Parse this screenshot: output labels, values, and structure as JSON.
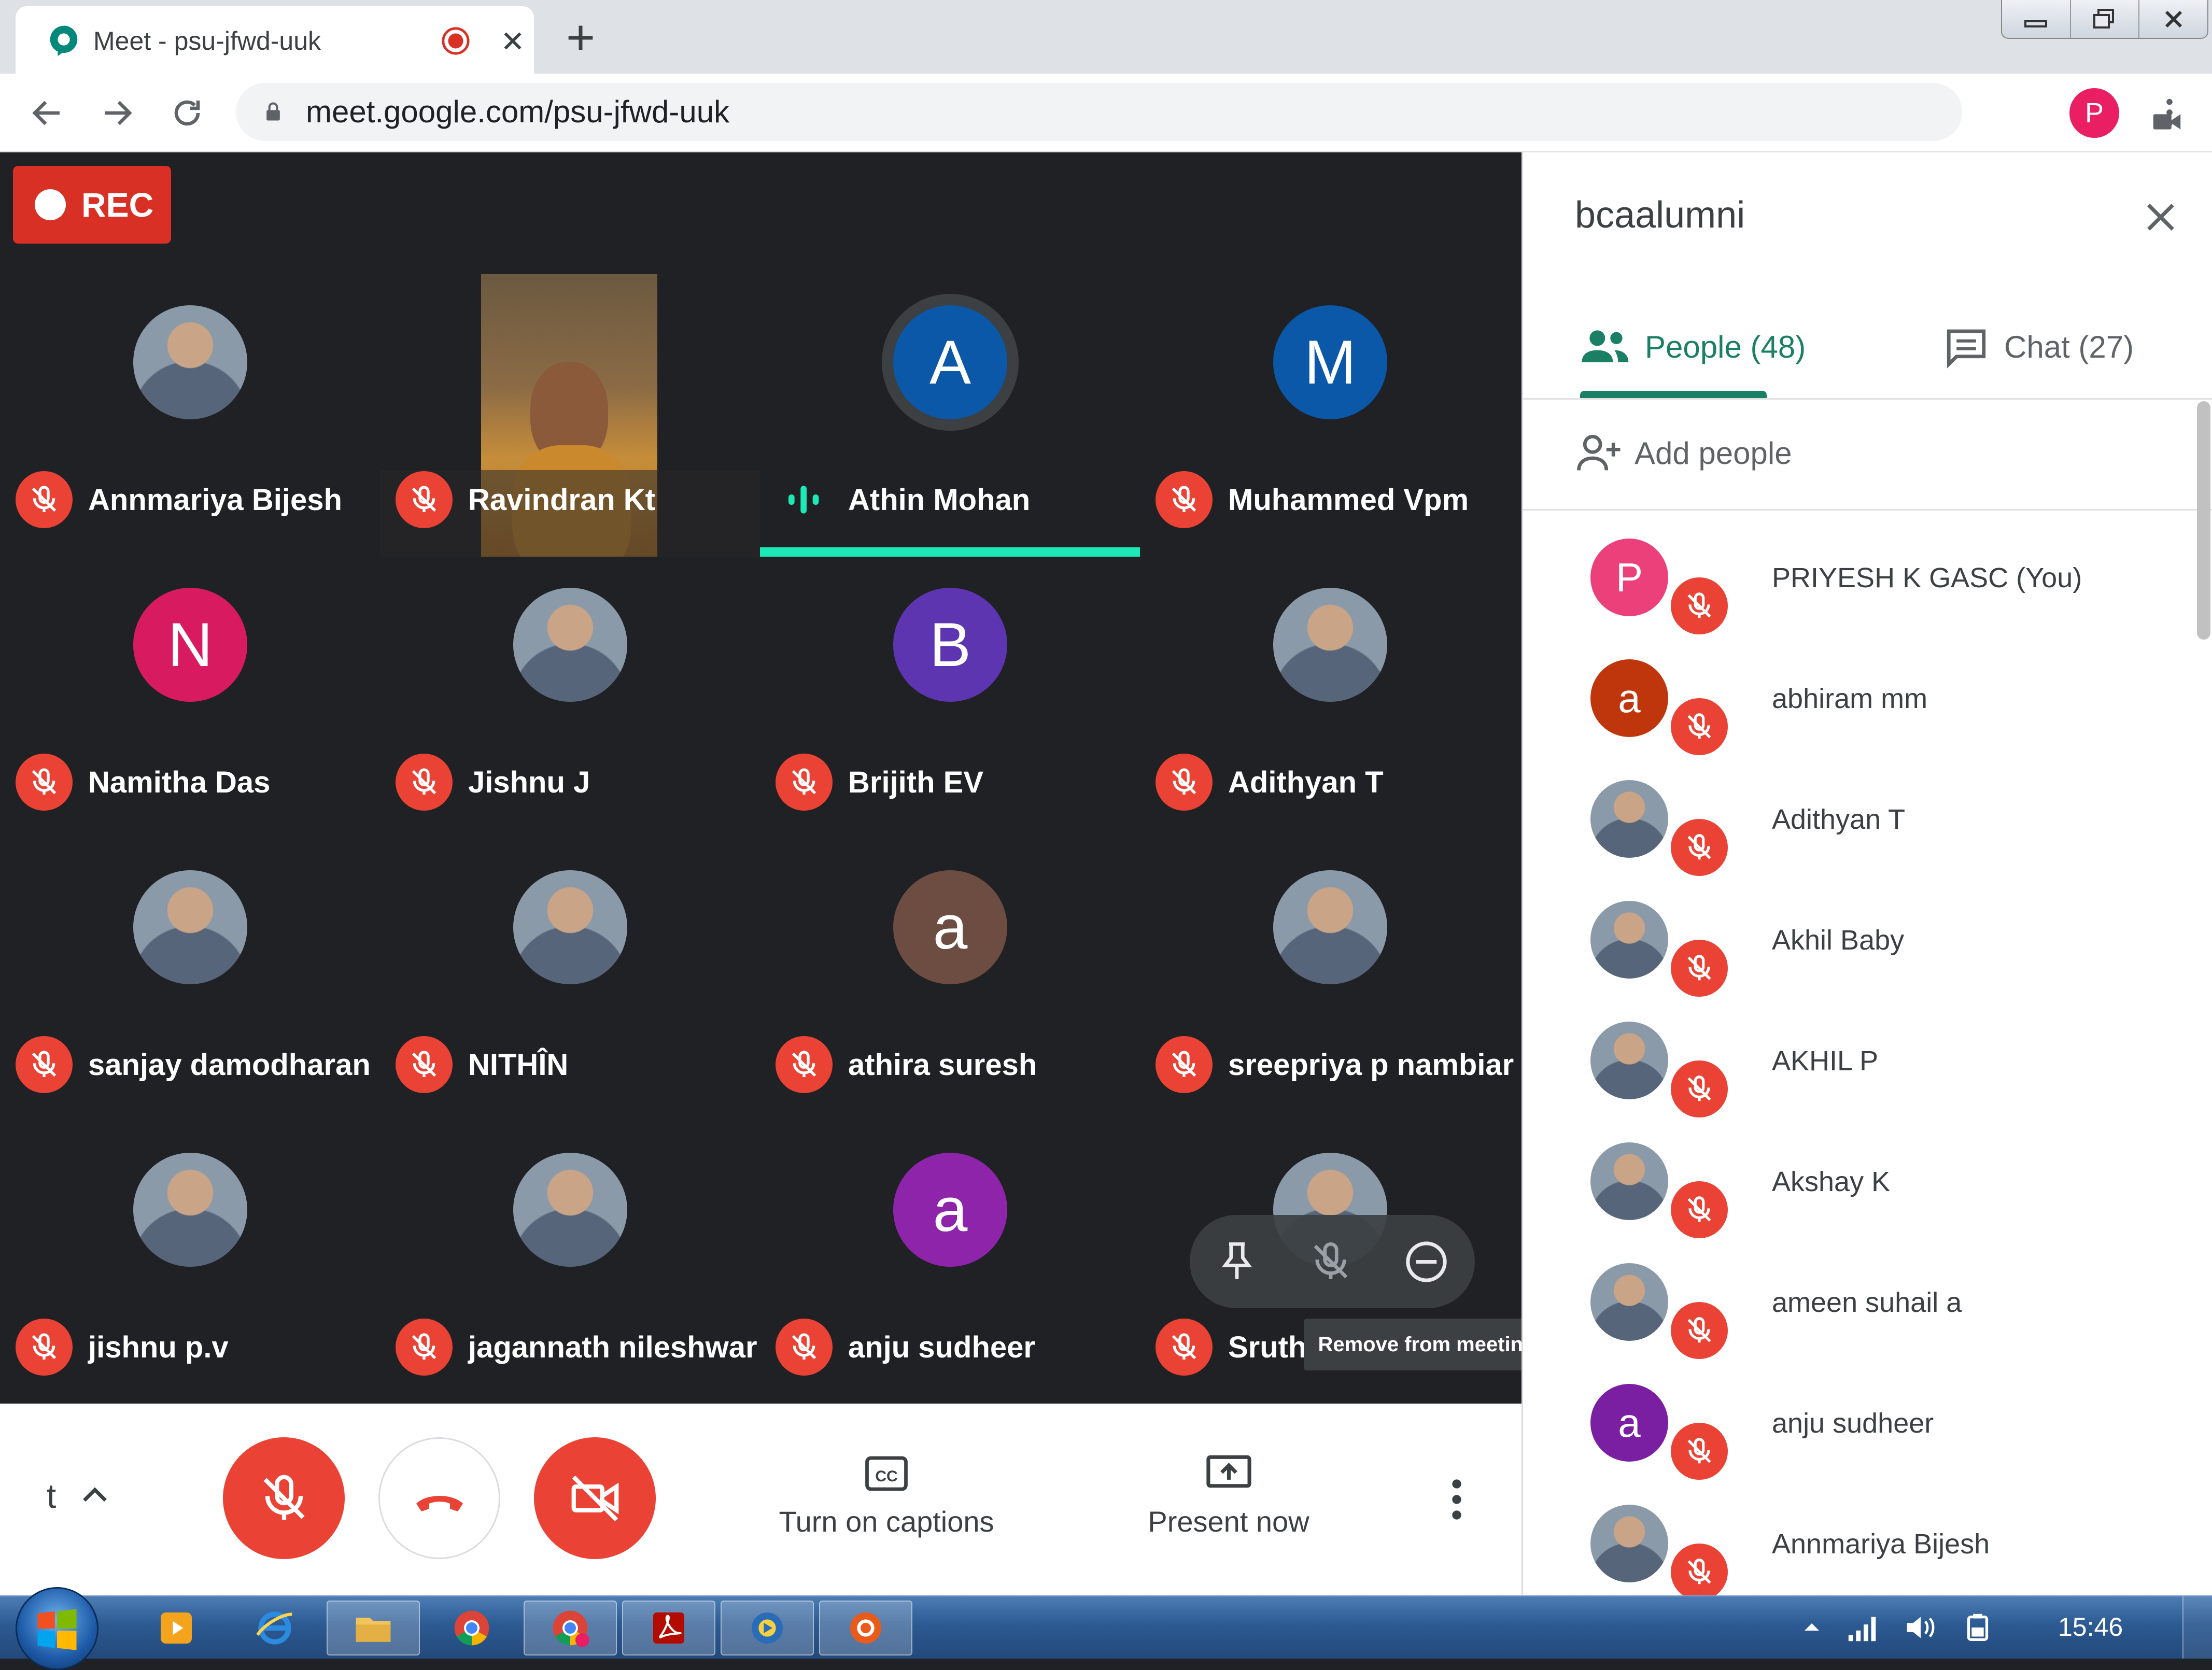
{
  "browser": {
    "tab_title": "Meet - psu-jfwd-uuk",
    "url": "meet.google.com/psu-jfwd-uuk",
    "profile_initial": "P",
    "profile_color": "#e91e63"
  },
  "meet": {
    "rec_label": "REC",
    "meeting_code_short": "t",
    "tiles": [
      {
        "name": "Annmariya Bijesh",
        "avatar_type": "photo",
        "muted": true
      },
      {
        "name": "Ravindran Kt",
        "avatar_type": "video",
        "muted": true
      },
      {
        "name": "Athin Mohan",
        "avatar_type": "letter",
        "initial": "A",
        "color": "#0b57a8",
        "muted": false,
        "speaking": true
      },
      {
        "name": "Muhammed Vpm",
        "avatar_type": "letter",
        "initial": "M",
        "color": "#0b57a8",
        "muted": true
      },
      {
        "name": "Namitha Das",
        "avatar_type": "letter",
        "initial": "N",
        "color": "#d81b60",
        "muted": true
      },
      {
        "name": "Jishnu J",
        "avatar_type": "photo",
        "muted": true
      },
      {
        "name": "Brijith EV",
        "avatar_type": "letter",
        "initial": "B",
        "color": "#5e35b1",
        "muted": true
      },
      {
        "name": "Adithyan T",
        "avatar_type": "photo",
        "muted": true
      },
      {
        "name": "sanjay damodharan",
        "avatar_type": "photo",
        "muted": true
      },
      {
        "name": "NITHÎN",
        "avatar_type": "photo",
        "muted": true
      },
      {
        "name": "athira suresh",
        "avatar_type": "letter",
        "initial": "a",
        "color": "#6d4c41",
        "muted": true
      },
      {
        "name": "sreepriya p nambiar",
        "avatar_type": "photo",
        "muted": true
      },
      {
        "name": "jishnu p.v",
        "avatar_type": "photo",
        "muted": true
      },
      {
        "name": "jagannath nileshwar",
        "avatar_type": "photo",
        "muted": true
      },
      {
        "name": "anju sudheer",
        "avatar_type": "letter",
        "initial": "a",
        "color": "#8e24aa",
        "muted": true
      },
      {
        "name": "Sruthi B Ramesan",
        "avatar_type": "photo",
        "muted": true
      }
    ],
    "tooltip": "Remove from meeting",
    "controls": {
      "captions_label": "Turn on captions",
      "present_label": "Present now"
    }
  },
  "panel": {
    "meeting_name": "bcaalumni",
    "people_tab": "People (48)",
    "chat_tab": "Chat (27)",
    "add_people": "Add people",
    "people": [
      {
        "name": "PRIYESH K GASC (You)",
        "avatar_type": "letter",
        "initial": "P",
        "color": "#ec407a"
      },
      {
        "name": "abhiram mm",
        "avatar_type": "letter",
        "initial": "a",
        "color": "#bf360c"
      },
      {
        "name": "Adithyan T",
        "avatar_type": "photo"
      },
      {
        "name": "Akhil Baby",
        "avatar_type": "photo"
      },
      {
        "name": "AKHIL P",
        "avatar_type": "photo"
      },
      {
        "name": "Akshay K",
        "avatar_type": "photo"
      },
      {
        "name": "ameen suhail a",
        "avatar_type": "photo"
      },
      {
        "name": "anju sudheer",
        "avatar_type": "letter",
        "initial": "a",
        "color": "#7b1fa2"
      },
      {
        "name": "Annmariya Bijesh",
        "avatar_type": "photo"
      }
    ]
  },
  "taskbar": {
    "clock": "15:46",
    "apps": [
      "media-player",
      "internet-explorer",
      "file-explorer",
      "chrome",
      "chrome-profile",
      "acrobat-reader",
      "media-center",
      "orange-app"
    ]
  },
  "colors": {
    "meet_bg": "#202124",
    "mute_red": "#ea4335",
    "speaking_teal": "#1de9b6",
    "accent_green": "#1a7f64"
  }
}
